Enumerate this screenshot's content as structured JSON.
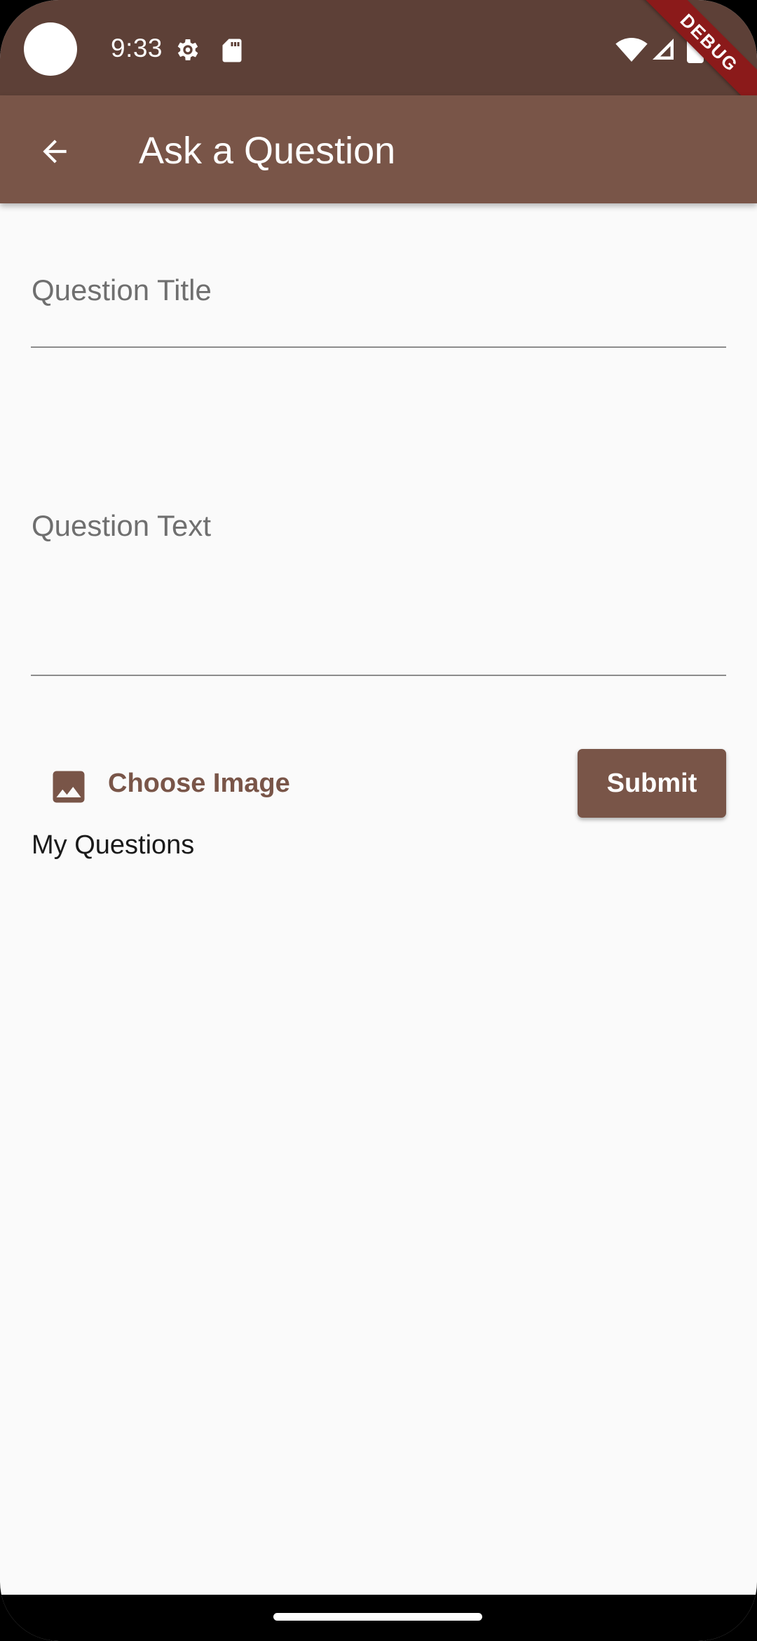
{
  "status_bar": {
    "time": "9:33",
    "icons": [
      "camera-cutout",
      "gear-icon",
      "sd-card-icon",
      "wifi-icon",
      "signal-icon",
      "battery-icon"
    ],
    "debug_banner": "DEBUG",
    "color": "#5d4037"
  },
  "app_bar": {
    "back_icon": "arrow-back-icon",
    "title": "Ask a Question",
    "color": "#795548"
  },
  "form": {
    "title_field": {
      "placeholder": "Question Title",
      "value": ""
    },
    "text_field": {
      "placeholder": "Question Text",
      "value": ""
    },
    "choose_image": {
      "icon": "image-icon",
      "label": "Choose Image"
    },
    "submit_label": "Submit"
  },
  "section": {
    "my_questions_label": "My Questions"
  },
  "colors": {
    "background": "#fafafa",
    "accent": "#795548",
    "debug": "#8b1a1a"
  }
}
